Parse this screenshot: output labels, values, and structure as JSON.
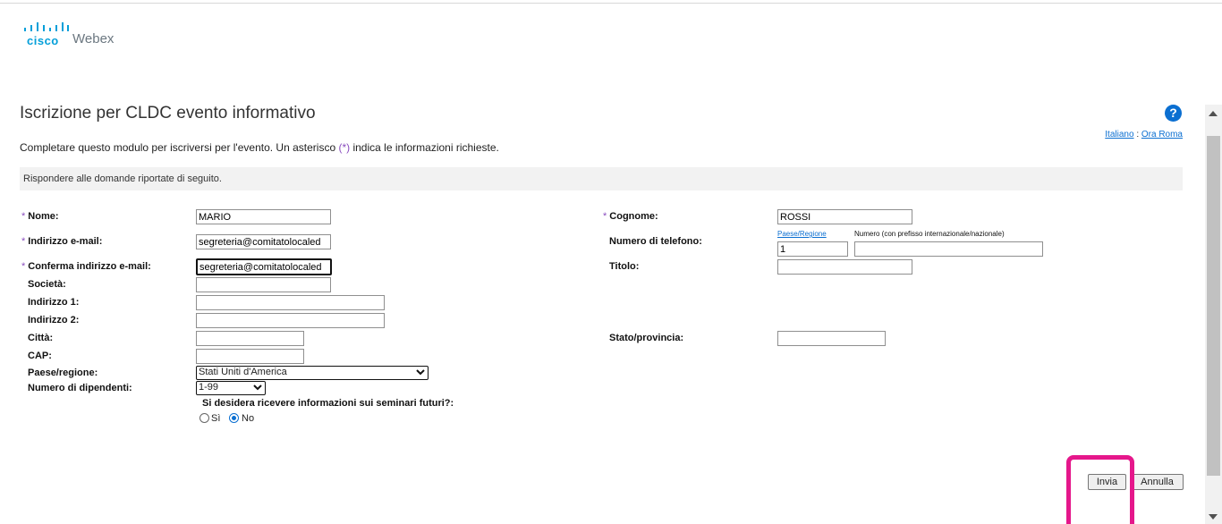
{
  "brand": {
    "cisco": "cisco",
    "webex": "Webex",
    "cisco_color": "#049fd9"
  },
  "header": {
    "title": "Iscrizione per CLDC evento informativo",
    "help_icon": "question-circle-icon",
    "language_link": "Italiano",
    "separator": ":",
    "timezone_link": "Ora Roma",
    "intro_before": "Completare questo modulo per iscriversi per l'evento. Un asterisco ",
    "intro_asterisk": "(*)",
    "intro_after": " indica le informazioni richieste.",
    "banner": "Rispondere alle domande riportate di seguito."
  },
  "form": {
    "asterisk": "*",
    "nome": {
      "label": "Nome:",
      "value": "MARIO"
    },
    "cognome": {
      "label": "Cognome:",
      "value": "ROSSI"
    },
    "email": {
      "label": "Indirizzo e-mail:",
      "value": "segreteria@comitatolocaled"
    },
    "telefono": {
      "label": "Numero di telefono:",
      "country_label": "Paese/Regione",
      "number_label": "Numero (con prefisso internazionale/nazionale)",
      "country_value": "1",
      "number_value": ""
    },
    "conferma_email": {
      "label": "Conferma indirizzo e-mail:",
      "value": "segreteria@comitatolocaled"
    },
    "titolo": {
      "label": "Titolo:",
      "value": ""
    },
    "societa": {
      "label": "Società:",
      "value": ""
    },
    "indirizzo1": {
      "label": "Indirizzo 1:",
      "value": ""
    },
    "indirizzo2": {
      "label": "Indirizzo 2:",
      "value": ""
    },
    "citta": {
      "label": "Città:",
      "value": ""
    },
    "stato": {
      "label": "Stato/provincia:",
      "value": ""
    },
    "cap": {
      "label": "CAP:",
      "value": ""
    },
    "paese": {
      "label": "Paese/regione:",
      "selected": "Stati Uniti d'America"
    },
    "dipendenti": {
      "label": "Numero di dipendenti:",
      "selected": "1-99"
    },
    "seminari": {
      "question": "Si desidera ricevere informazioni sui seminari futuri?:",
      "opt_yes": "Sì",
      "opt_no": "No",
      "selected": "No"
    }
  },
  "buttons": {
    "submit": "Invia",
    "cancel": "Annulla"
  },
  "annotation": {
    "highlight_color": "#e5178b"
  }
}
